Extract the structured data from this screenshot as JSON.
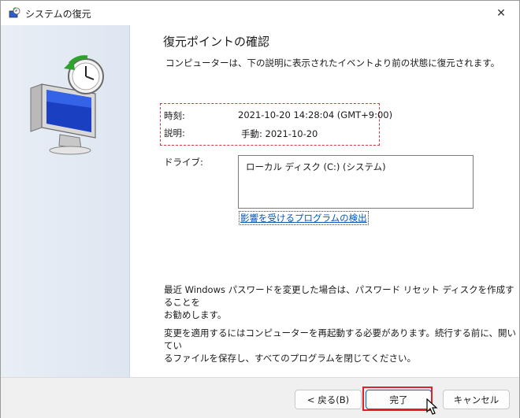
{
  "window": {
    "title": "システムの復元",
    "close_glyph": "✕"
  },
  "page": {
    "heading": "復元ポイントの確認",
    "intro": "コンピューターは、下の説明に表示されたイベントより前の状態に復元されます。",
    "time_label": "時刻:",
    "time_value": "2021-10-20 14:28:04 (GMT+9:00)",
    "desc_label": "説明:",
    "desc_value": "手動: 2021-10-20",
    "drive_label": "ドライブ:",
    "drives": [
      "ローカル ディスク (C:) (システム)"
    ],
    "scan_link": "影響を受けるプログラムの検出",
    "password_note_line1": "最近 Windows パスワードを変更した場合は、パスワード リセット ディスクを作成することを",
    "password_note_line2": "お勧めします。",
    "restart_note_line1": "変更を適用するにはコンピューターを再起動する必要があります。続行する前に、開いてい",
    "restart_note_line2": "るファイルを保存し、すべてのプログラムを閉じてください。"
  },
  "footer": {
    "back_label": "< 戻る(B)",
    "finish_label": "完了",
    "cancel_label": "キャンセル"
  },
  "colors": {
    "accent": "#0067c0",
    "highlight": "#e0202a",
    "link": "#0a55b5"
  }
}
